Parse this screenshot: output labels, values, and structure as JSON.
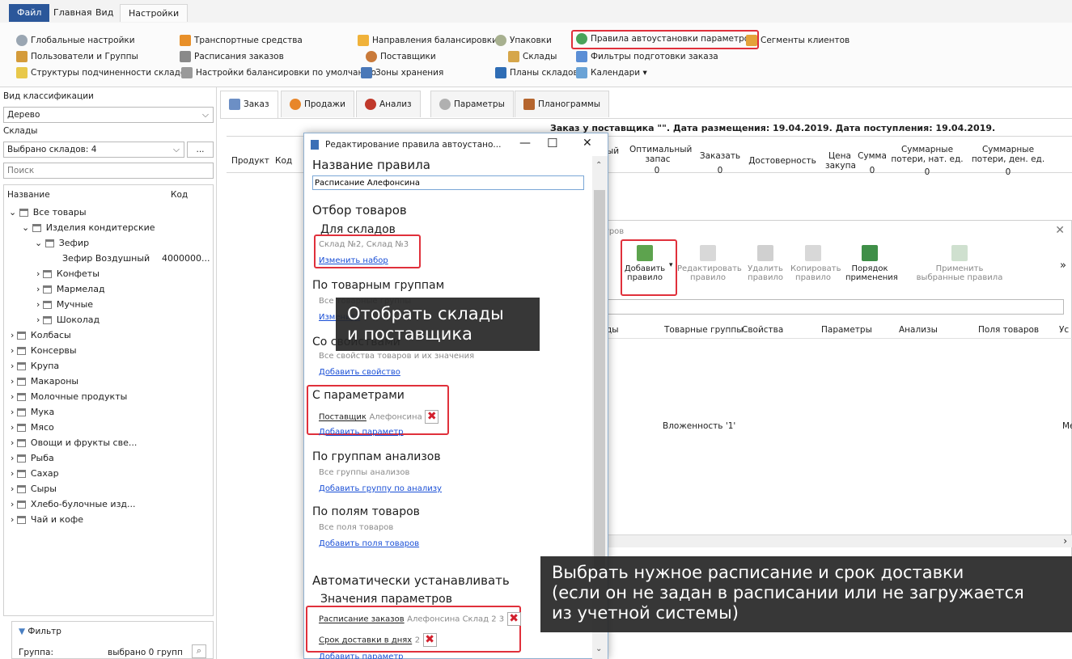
{
  "ribbon": {
    "tabs": [
      "Файл",
      "Главная",
      "Вид",
      "Настройки"
    ],
    "row1": [
      "Глобальные настройки",
      "Транспортные средства",
      "Направления балансировки",
      "Упаковки",
      "Правила автоустановки параметров",
      "Сегменты клиентов"
    ],
    "row2": [
      "Пользователи и Группы",
      "Расписания заказов",
      "Поставщики",
      "Склады",
      "Фильтры подготовки заказа"
    ],
    "row3": [
      "Структуры подчиненности складов",
      "Настройки балансировки по умолчанию",
      "Зоны хранения",
      "Планы складов",
      "Календари"
    ]
  },
  "left": {
    "classification_label": "Вид классификации",
    "classification_value": "Дерево",
    "warehouses_label": "Склады",
    "warehouses_value": "Выбрано складов: 4",
    "more_btn": "...",
    "search_placeholder": "Поиск",
    "col_name": "Название",
    "col_code": "Код",
    "tree": [
      "Все товары",
      "Изделия кондитерские",
      "Зефир",
      "Зефир Воздушный",
      "Конфеты",
      "Мармелад",
      "Мучные",
      "Шоколад",
      "Колбасы",
      "Консервы",
      "Крупа",
      "Макароны",
      "Молочные продукты",
      "Мука",
      "Мясо",
      "Овощи и фрукты све...",
      "Рыба",
      "Сахар",
      "Сыры",
      "Хлебо-булочные изд...",
      "Чай и кофе"
    ],
    "zefir_code": "4000000...",
    "filter_label": "Фильтр",
    "group_label": "Группа:",
    "group_value": "выбрано 0 групп"
  },
  "main": {
    "tabs": [
      "Заказ",
      "Продажи",
      "Анализ",
      "Параметры",
      "Планограммы"
    ],
    "order_header": "Заказ у поставщика \"\". Дата размещения: 19.04.2019. Дата поступления: 19.04.2019.",
    "col_product": "Продукт",
    "col_code": "Код",
    "col_partial": "ый",
    "col_optimal": "Оптимальный запас",
    "col_order": "Заказать",
    "col_reliability": "Достоверность",
    "col_price": "Цена закупа",
    "col_sum": "Сумма",
    "col_loss_nat": "Суммарные потери, нат. ед.",
    "col_loss_money": "Суммарные потери, ден. ед.",
    "zero": "0"
  },
  "rules_dialog": {
    "title_partial": "тров",
    "add_rule": "Добавить правило",
    "edit_rule": "Редактировать правило",
    "delete_rule": "Удалить правило",
    "copy_rule": "Копировать правило",
    "apply_order": "Порядок применения",
    "apply_selected": "Применить выбранные правила",
    "more": "»",
    "col_partial": "ды",
    "col_groups": "Товарные группы",
    "col_props": "Свойства",
    "col_params": "Параметры",
    "col_analyses": "Анализы",
    "col_fields": "Поля товаров",
    "col_more": "Ус",
    "row_nesting": "Вложенность '1'",
    "row_more": "Ме",
    "scroll_right": "›"
  },
  "edit_dialog": {
    "title": "Редактирование правила автоустано...",
    "min": "—",
    "max": "☐",
    "close": "✕",
    "rule_name_label": "Название правила",
    "rule_name_value": "Расписание Алефонсина",
    "goods_selection": "Отбор товаров",
    "for_warehouses": "Для складов",
    "warehouses_value": "Склад №2, Склад №3",
    "change_set": "Изменить набор",
    "by_groups": "По товарным группам",
    "groups_value": "Все товарные группы",
    "groups_link": "Изменить",
    "with_props": "Со свойствами",
    "props_value": "Все свойства товаров и их значения",
    "add_prop": "Добавить свойство",
    "with_params": "С параметрами",
    "param_supplier": "Поставщик",
    "param_supplier_value": "Алефонсина",
    "add_param": "Добавить параметр",
    "by_analysis_groups": "По группам анализов",
    "analysis_value": "Все группы анализов",
    "add_analysis": "Добавить группу по анализу",
    "by_fields": "По полям товаров",
    "fields_value": "Все поля товаров",
    "add_fields": "Добавить поля товаров",
    "auto_set": "Автоматически устанавливать",
    "param_values": "Значения параметров",
    "schedule_label": "Расписание заказов",
    "schedule_value": "Алефонсина Склад 2 3",
    "delivery_label": "Срок доставки в днях",
    "delivery_value": "2",
    "add_param2": "Добавить параметр",
    "remove": "✖"
  },
  "tooltips": {
    "select_tip": "Отобрать склады\nи поставщика",
    "choose_tip": "Выбрать нужное расписание и срок доставки\n(если он не задан в расписании или не загружается\nиз учетной системы)"
  },
  "colors": {
    "accent": "#2b579a",
    "highlight": "#e0303b",
    "link": "#1a4fd6"
  }
}
